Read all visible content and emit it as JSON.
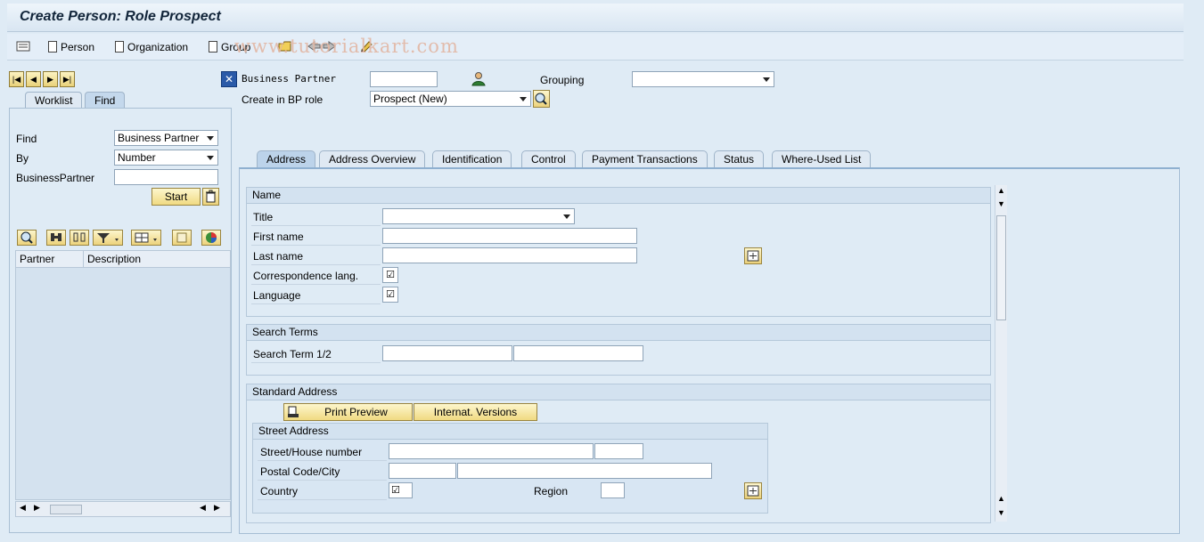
{
  "window": {
    "title": "Create Person: Role Prospect"
  },
  "watermark": "www.tutorialkart.com",
  "toolbar": {
    "person_label": "Person",
    "organization_label": "Organization",
    "group_label": "Group"
  },
  "header": {
    "business_partner_label": "Business Partner",
    "business_partner_value": "",
    "grouping_label": "Grouping",
    "grouping_value": "",
    "create_in_role_label": "Create in BP role",
    "create_in_role_value": "Prospect (New)"
  },
  "left_panel": {
    "tabs": [
      {
        "label": "Worklist"
      },
      {
        "label": "Find"
      }
    ],
    "find_label": "Find",
    "find_value": "Business Partner",
    "by_label": "By",
    "by_value": "Number",
    "bp_label": "BusinessPartner",
    "bp_value": "",
    "start_label": "Start",
    "columns": [
      "Partner",
      "Description"
    ]
  },
  "tabs": [
    {
      "label": "Address"
    },
    {
      "label": "Address Overview"
    },
    {
      "label": "Identification"
    },
    {
      "label": "Control"
    },
    {
      "label": "Payment Transactions"
    },
    {
      "label": "Status"
    },
    {
      "label": "Where-Used List"
    }
  ],
  "name_section": {
    "header": "Name",
    "title_label": "Title",
    "title_value": "",
    "first_name_label": "First name",
    "last_name_label": "Last name",
    "correspondence_label": "Correspondence lang.",
    "language_label": "Language"
  },
  "search_terms": {
    "header": "Search Terms",
    "label": "Search Term 1/2"
  },
  "standard_address": {
    "header": "Standard Address",
    "print_preview": "Print Preview",
    "internat_versions": "Internat. Versions",
    "street_header": "Street Address",
    "street_label": "Street/House number",
    "postal_label": "Postal Code/City",
    "country_label": "Country",
    "region_label": "Region"
  }
}
